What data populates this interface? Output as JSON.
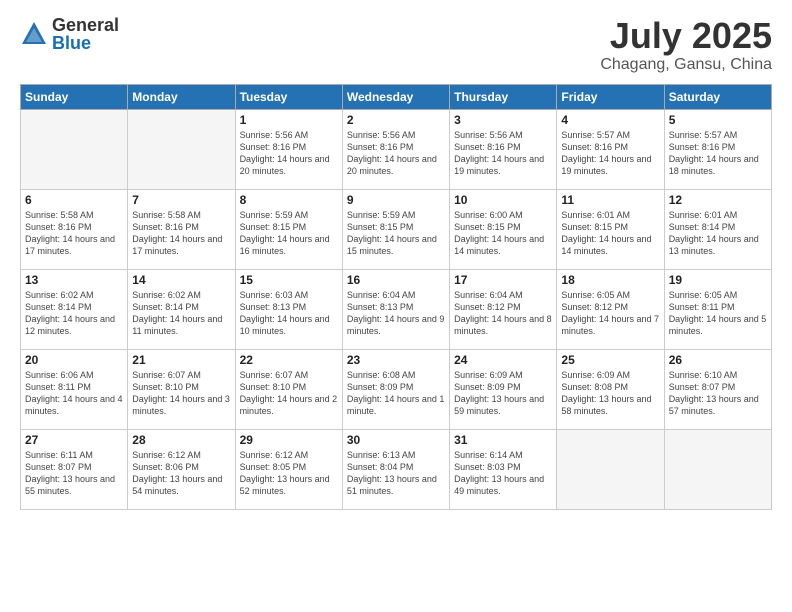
{
  "logo": {
    "general": "General",
    "blue": "Blue"
  },
  "title": "July 2025",
  "subtitle": "Chagang, Gansu, China",
  "headers": [
    "Sunday",
    "Monday",
    "Tuesday",
    "Wednesday",
    "Thursday",
    "Friday",
    "Saturday"
  ],
  "weeks": [
    [
      {
        "day": "",
        "sunrise": "",
        "sunset": "",
        "daylight": "",
        "empty": true
      },
      {
        "day": "",
        "sunrise": "",
        "sunset": "",
        "daylight": "",
        "empty": true
      },
      {
        "day": "1",
        "sunrise": "Sunrise: 5:56 AM",
        "sunset": "Sunset: 8:16 PM",
        "daylight": "Daylight: 14 hours and 20 minutes.",
        "empty": false
      },
      {
        "day": "2",
        "sunrise": "Sunrise: 5:56 AM",
        "sunset": "Sunset: 8:16 PM",
        "daylight": "Daylight: 14 hours and 20 minutes.",
        "empty": false
      },
      {
        "day": "3",
        "sunrise": "Sunrise: 5:56 AM",
        "sunset": "Sunset: 8:16 PM",
        "daylight": "Daylight: 14 hours and 19 minutes.",
        "empty": false
      },
      {
        "day": "4",
        "sunrise": "Sunrise: 5:57 AM",
        "sunset": "Sunset: 8:16 PM",
        "daylight": "Daylight: 14 hours and 19 minutes.",
        "empty": false
      },
      {
        "day": "5",
        "sunrise": "Sunrise: 5:57 AM",
        "sunset": "Sunset: 8:16 PM",
        "daylight": "Daylight: 14 hours and 18 minutes.",
        "empty": false
      }
    ],
    [
      {
        "day": "6",
        "sunrise": "Sunrise: 5:58 AM",
        "sunset": "Sunset: 8:16 PM",
        "daylight": "Daylight: 14 hours and 17 minutes.",
        "empty": false
      },
      {
        "day": "7",
        "sunrise": "Sunrise: 5:58 AM",
        "sunset": "Sunset: 8:16 PM",
        "daylight": "Daylight: 14 hours and 17 minutes.",
        "empty": false
      },
      {
        "day": "8",
        "sunrise": "Sunrise: 5:59 AM",
        "sunset": "Sunset: 8:15 PM",
        "daylight": "Daylight: 14 hours and 16 minutes.",
        "empty": false
      },
      {
        "day": "9",
        "sunrise": "Sunrise: 5:59 AM",
        "sunset": "Sunset: 8:15 PM",
        "daylight": "Daylight: 14 hours and 15 minutes.",
        "empty": false
      },
      {
        "day": "10",
        "sunrise": "Sunrise: 6:00 AM",
        "sunset": "Sunset: 8:15 PM",
        "daylight": "Daylight: 14 hours and 14 minutes.",
        "empty": false
      },
      {
        "day": "11",
        "sunrise": "Sunrise: 6:01 AM",
        "sunset": "Sunset: 8:15 PM",
        "daylight": "Daylight: 14 hours and 14 minutes.",
        "empty": false
      },
      {
        "day": "12",
        "sunrise": "Sunrise: 6:01 AM",
        "sunset": "Sunset: 8:14 PM",
        "daylight": "Daylight: 14 hours and 13 minutes.",
        "empty": false
      }
    ],
    [
      {
        "day": "13",
        "sunrise": "Sunrise: 6:02 AM",
        "sunset": "Sunset: 8:14 PM",
        "daylight": "Daylight: 14 hours and 12 minutes.",
        "empty": false
      },
      {
        "day": "14",
        "sunrise": "Sunrise: 6:02 AM",
        "sunset": "Sunset: 8:14 PM",
        "daylight": "Daylight: 14 hours and 11 minutes.",
        "empty": false
      },
      {
        "day": "15",
        "sunrise": "Sunrise: 6:03 AM",
        "sunset": "Sunset: 8:13 PM",
        "daylight": "Daylight: 14 hours and 10 minutes.",
        "empty": false
      },
      {
        "day": "16",
        "sunrise": "Sunrise: 6:04 AM",
        "sunset": "Sunset: 8:13 PM",
        "daylight": "Daylight: 14 hours and 9 minutes.",
        "empty": false
      },
      {
        "day": "17",
        "sunrise": "Sunrise: 6:04 AM",
        "sunset": "Sunset: 8:12 PM",
        "daylight": "Daylight: 14 hours and 8 minutes.",
        "empty": false
      },
      {
        "day": "18",
        "sunrise": "Sunrise: 6:05 AM",
        "sunset": "Sunset: 8:12 PM",
        "daylight": "Daylight: 14 hours and 7 minutes.",
        "empty": false
      },
      {
        "day": "19",
        "sunrise": "Sunrise: 6:05 AM",
        "sunset": "Sunset: 8:11 PM",
        "daylight": "Daylight: 14 hours and 5 minutes.",
        "empty": false
      }
    ],
    [
      {
        "day": "20",
        "sunrise": "Sunrise: 6:06 AM",
        "sunset": "Sunset: 8:11 PM",
        "daylight": "Daylight: 14 hours and 4 minutes.",
        "empty": false
      },
      {
        "day": "21",
        "sunrise": "Sunrise: 6:07 AM",
        "sunset": "Sunset: 8:10 PM",
        "daylight": "Daylight: 14 hours and 3 minutes.",
        "empty": false
      },
      {
        "day": "22",
        "sunrise": "Sunrise: 6:07 AM",
        "sunset": "Sunset: 8:10 PM",
        "daylight": "Daylight: 14 hours and 2 minutes.",
        "empty": false
      },
      {
        "day": "23",
        "sunrise": "Sunrise: 6:08 AM",
        "sunset": "Sunset: 8:09 PM",
        "daylight": "Daylight: 14 hours and 1 minute.",
        "empty": false
      },
      {
        "day": "24",
        "sunrise": "Sunrise: 6:09 AM",
        "sunset": "Sunset: 8:09 PM",
        "daylight": "Daylight: 13 hours and 59 minutes.",
        "empty": false
      },
      {
        "day": "25",
        "sunrise": "Sunrise: 6:09 AM",
        "sunset": "Sunset: 8:08 PM",
        "daylight": "Daylight: 13 hours and 58 minutes.",
        "empty": false
      },
      {
        "day": "26",
        "sunrise": "Sunrise: 6:10 AM",
        "sunset": "Sunset: 8:07 PM",
        "daylight": "Daylight: 13 hours and 57 minutes.",
        "empty": false
      }
    ],
    [
      {
        "day": "27",
        "sunrise": "Sunrise: 6:11 AM",
        "sunset": "Sunset: 8:07 PM",
        "daylight": "Daylight: 13 hours and 55 minutes.",
        "empty": false
      },
      {
        "day": "28",
        "sunrise": "Sunrise: 6:12 AM",
        "sunset": "Sunset: 8:06 PM",
        "daylight": "Daylight: 13 hours and 54 minutes.",
        "empty": false
      },
      {
        "day": "29",
        "sunrise": "Sunrise: 6:12 AM",
        "sunset": "Sunset: 8:05 PM",
        "daylight": "Daylight: 13 hours and 52 minutes.",
        "empty": false
      },
      {
        "day": "30",
        "sunrise": "Sunrise: 6:13 AM",
        "sunset": "Sunset: 8:04 PM",
        "daylight": "Daylight: 13 hours and 51 minutes.",
        "empty": false
      },
      {
        "day": "31",
        "sunrise": "Sunrise: 6:14 AM",
        "sunset": "Sunset: 8:03 PM",
        "daylight": "Daylight: 13 hours and 49 minutes.",
        "empty": false
      },
      {
        "day": "",
        "sunrise": "",
        "sunset": "",
        "daylight": "",
        "empty": true
      },
      {
        "day": "",
        "sunrise": "",
        "sunset": "",
        "daylight": "",
        "empty": true
      }
    ]
  ]
}
